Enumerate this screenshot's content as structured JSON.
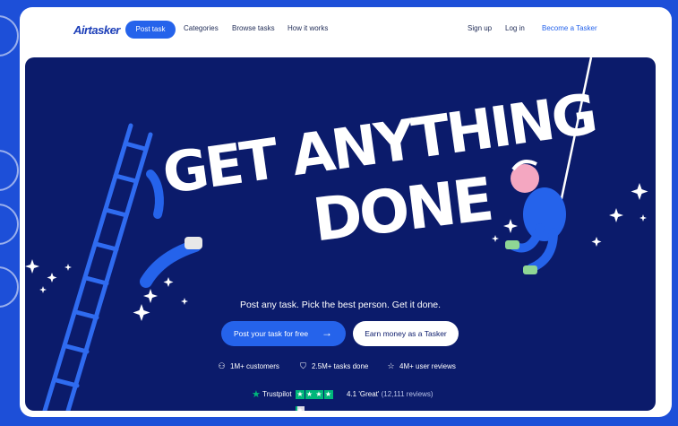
{
  "nav": {
    "logo": "Airtasker",
    "post_task": "Post task",
    "categories": "Categories",
    "browse_tasks": "Browse tasks",
    "how_it_works": "How it works",
    "sign_up": "Sign up",
    "log_in": "Log in",
    "become_tasker": "Become a Tasker"
  },
  "hero": {
    "headline_line1": "GET ANYTHING",
    "headline_line2": "DONE",
    "tagline": "Post any task. Pick the best person. Get it done.",
    "primary_cta": "Post your task for free",
    "secondary_cta": "Earn money as a Tasker",
    "stats": [
      {
        "icon": "users-icon",
        "text": "1M+ customers"
      },
      {
        "icon": "shield-check-icon",
        "text": "2.5M+ tasks done"
      },
      {
        "icon": "star-outline-icon",
        "text": "4M+ user reviews"
      }
    ],
    "trustpilot": {
      "brand": "Trustpilot",
      "score": "4.1 'Great'",
      "reviews": "(12,111 reviews)",
      "stars": 4.1
    }
  },
  "colors": {
    "page_bg": "#1d4fd8",
    "hero_bg": "#0b1b6b",
    "accent": "#2563eb",
    "trustpilot_green": "#00b67a"
  }
}
